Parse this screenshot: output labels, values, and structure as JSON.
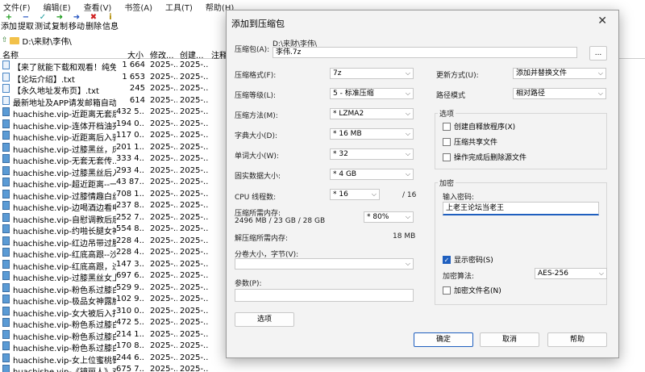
{
  "menu": [
    "文件(F)",
    "编辑(E)",
    "查看(V)",
    "书签(A)",
    "工具(T)",
    "帮助(H)"
  ],
  "toolbar": [
    {
      "label": "添加",
      "icon": "plus-icon",
      "glyph": "+",
      "color": "#1a9a1a"
    },
    {
      "label": "提取",
      "icon": "minus-icon",
      "glyph": "−",
      "color": "#1f4fbf"
    },
    {
      "label": "测试",
      "icon": "check-icon",
      "glyph": "✓",
      "color": "#1a9a9a"
    },
    {
      "label": "复制",
      "icon": "arrow-right-icon",
      "glyph": "➜",
      "color": "#1a9a1a"
    },
    {
      "label": "移动",
      "icon": "move-arrow-icon",
      "glyph": "➜",
      "color": "#1f4fbf"
    },
    {
      "label": "删除",
      "icon": "delete-x-icon",
      "glyph": "✖",
      "color": "#d02020"
    },
    {
      "label": "信息",
      "icon": "info-icon",
      "glyph": "i",
      "color": "#b08a00"
    }
  ],
  "address": "D:\\来财\\李伟\\",
  "columns": {
    "name": "名称",
    "size": "大小",
    "modified": "修改...",
    "created": "创建...",
    "comment": "注释"
  },
  "files": [
    {
      "name": "【来了就能下载和观看！纯免...",
      "size": "1 664",
      "mod": "2025-...",
      "cre": "2025-...",
      "type": "doc"
    },
    {
      "name": "【论坛介绍】.txt",
      "size": "1 653",
      "mod": "2025-...",
      "cre": "2025-...",
      "type": "doc"
    },
    {
      "name": "【永久地址发布页】.txt",
      "size": "245",
      "mod": "2025-...",
      "cre": "2025-...",
      "type": "doc"
    },
    {
      "name": "最新地址及APP请发邮箱自动...",
      "size": "614",
      "mod": "2025-...",
      "cre": "2025-...",
      "type": "doc"
    },
    {
      "name": "huachishe.vip-近距离无套后...",
      "size": "432 5...",
      "mod": "2025-...",
      "cre": "2025-...",
      "type": "img"
    },
    {
      "name": "huachishe.vip-连体开档油亮...",
      "size": "194 0...",
      "mod": "2025-...",
      "cre": "2025-...",
      "type": "img"
    },
    {
      "name": "huachishe.vip-近距离后入骑...",
      "size": "117 0...",
      "mod": "2025-...",
      "cre": "2025-...",
      "type": "img"
    },
    {
      "name": "huachishe.vip-过膝黑丝，床...",
      "size": "201 1...",
      "mod": "2025-...",
      "cre": "2025-...",
      "type": "img"
    },
    {
      "name": "huachishe.vip-无套无套传...",
      "size": "333 4...",
      "mod": "2025-...",
      "cre": "2025-...",
      "type": "img"
    },
    {
      "name": "huachishe.vip-过膝黑丝后入...",
      "size": "293 4...",
      "mod": "2025-...",
      "cre": "2025-...",
      "type": "img"
    },
    {
      "name": "huachishe.vip-超近距离--一...",
      "size": "43 87...",
      "mod": "2025-...",
      "cre": "2025-...",
      "type": "img"
    },
    {
      "name": "huachishe.vip-过膝情趣白丝...",
      "size": "708 1...",
      "mod": "2025-...",
      "cre": "2025-...",
      "type": "img"
    },
    {
      "name": "huachishe.vip-边喝酒边看电...",
      "size": "237 8...",
      "mod": "2025-...",
      "cre": "2025-...",
      "type": "img"
    },
    {
      "name": "huachishe.vip-自慰调教后后...",
      "size": "252 7...",
      "mod": "2025-...",
      "cre": "2025-...",
      "type": "img"
    },
    {
      "name": "huachishe.vip-约啪长腿女神...",
      "size": "554 8...",
      "mod": "2025-...",
      "cre": "2025-...",
      "type": "img"
    },
    {
      "name": "huachishe.vip-红边吊带过膝...",
      "size": "228 4...",
      "mod": "2025-...",
      "cre": "2025-...",
      "type": "img"
    },
    {
      "name": "huachishe.vip-红底高跟--沙...",
      "size": "228 4...",
      "mod": "2025-...",
      "cre": "2025-...",
      "type": "img"
    },
    {
      "name": "huachishe.vip-红底高跟，过...",
      "size": "147 3...",
      "mod": "2025-...",
      "cre": "2025-...",
      "type": "img"
    },
    {
      "name": "huachishe.vip-过膝黑丝女上...",
      "size": "697 6...",
      "mod": "2025-...",
      "cre": "2025-...",
      "type": "img"
    },
    {
      "name": "huachishe.vip-粉色系过膝白...",
      "size": "529 9...",
      "mod": "2025-...",
      "cre": "2025-...",
      "type": "img"
    },
    {
      "name": "huachishe.vip-极品女神露脸...",
      "size": "102 9...",
      "mod": "2025-...",
      "cre": "2025-...",
      "type": "img"
    },
    {
      "name": "huachishe.vip-女大被后入打...",
      "size": "310 0...",
      "mod": "2025-...",
      "cre": "2025-...",
      "type": "img"
    },
    {
      "name": "huachishe.vip-粉色系过膝白...",
      "size": "472 5...",
      "mod": "2025-...",
      "cre": "2025-...",
      "type": "img"
    },
    {
      "name": "huachishe.vip-粉色系过膝白...",
      "size": "214 1...",
      "mod": "2025-...",
      "cre": "2025-...",
      "type": "img"
    },
    {
      "name": "huachishe.vip-粉色系过膝白...",
      "size": "170 8...",
      "mod": "2025-...",
      "cre": "2025-...",
      "type": "img"
    },
    {
      "name": "huachishe.vip-女上位蜜桃臀...",
      "size": "244 6...",
      "mod": "2025-...",
      "cre": "2025-...",
      "type": "img"
    },
    {
      "name": "huachishe.vip-《镜丽人》对...",
      "size": "675 7...",
      "mod": "2025-...",
      "cre": "2025-...",
      "type": "img"
    }
  ],
  "dialog": {
    "title": "添加到压缩包",
    "archive_label": "压缩包(A):",
    "archive_path": "D:\\来财\\李伟\\",
    "archive_name": "李伟.7z",
    "browse": "...",
    "format_label": "压缩格式(F):",
    "format_value": "7z",
    "level_label": "压缩等级(L):",
    "level_value": "5 - 标准压缩",
    "method_label": "压缩方法(M):",
    "method_value": "*  LZMA2",
    "dict_label": "字典大小(D):",
    "dict_value": "*  16 MB",
    "word_label": "单词大小(W):",
    "word_value": "*  32",
    "solid_label": "固实数据大小:",
    "solid_value": "*  4 GB",
    "threads_label": "CPU 线程数:",
    "threads_value": "*  16",
    "threads_total": "/ 16",
    "memcomp_label": "压缩所需内存:",
    "memcomp_value": "2496 MB / 23 GB / 28 GB",
    "memcomp_pct": "* 80%",
    "memdecomp_label": "解压缩所需内存:",
    "memdecomp_value": "18 MB",
    "split_label": "分卷大小，字节(V):",
    "params_label": "参数(P):",
    "options_button": "选项",
    "update_label": "更新方式(U):",
    "update_value": "添加并替换文件",
    "path_label": "路径模式",
    "path_value": "相对路径",
    "options_title": "选项",
    "opt_sfx": "创建自释放程序(X)",
    "opt_shared": "压缩共享文件",
    "opt_delete": "操作完成后删除源文件",
    "enc_title": "加密",
    "pwd_label": "输入密码:",
    "pwd_value": "上老王论坛当老王",
    "show_pwd": "显示密码(S)",
    "enc_method_label": "加密算法:",
    "enc_method_value": "AES-256",
    "enc_names": "加密文件名(N)",
    "ok": "确定",
    "cancel": "取消",
    "help": "帮助"
  }
}
